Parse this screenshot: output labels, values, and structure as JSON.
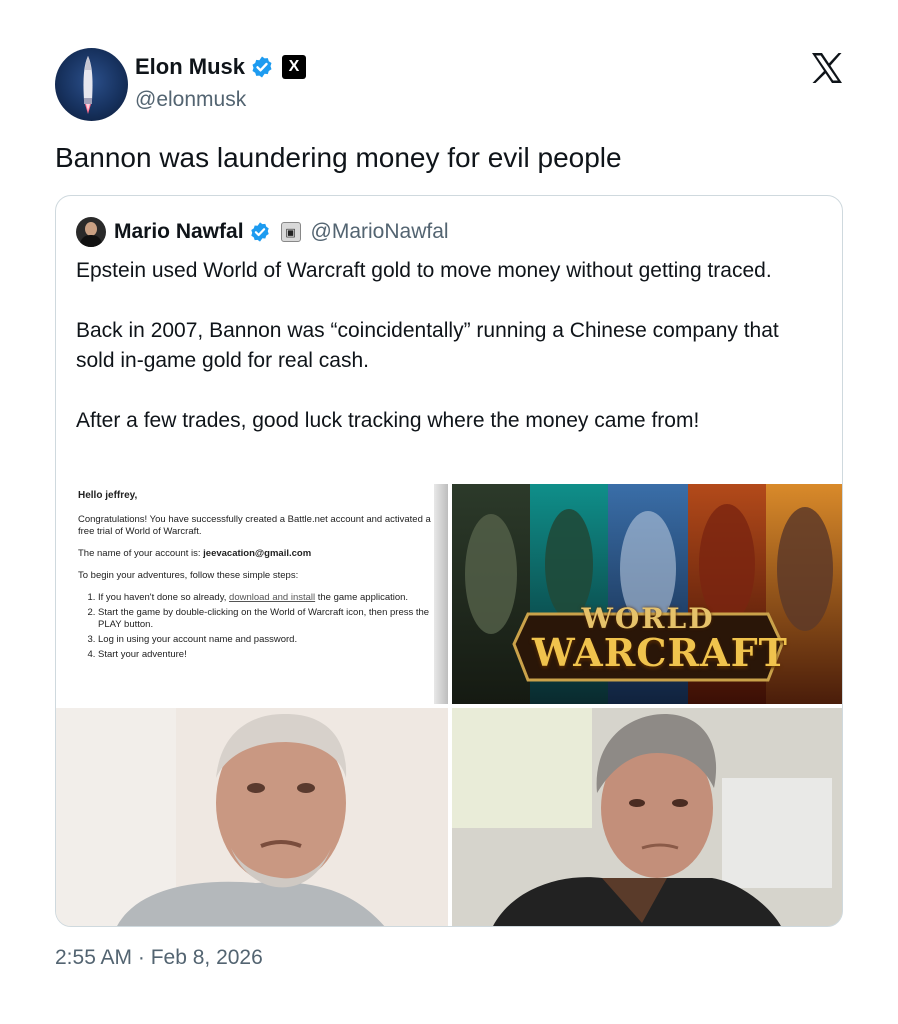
{
  "author": {
    "name": "Elon Musk",
    "handle": "@elonmusk",
    "avatar_icon": "rocket-avatar",
    "affiliation_badge": "X"
  },
  "platform_logo": "x-logo",
  "tweet": {
    "text": "Bannon was laundering money for evil people",
    "timestamp": "2:55 AM · Feb 8, 2026"
  },
  "quoted_tweet": {
    "name": "Mario Nawfal",
    "handle": "@MarioNawfal",
    "paragraphs": [
      "Epstein used World of Warcraft gold to move money without getting traced.",
      "Back in 2007, Bannon was “coincidentally” running a Chinese company that sold in-game gold for real cash.",
      "After a few trades, good luck tracking where the money came from!"
    ],
    "media": {
      "email": {
        "greeting": "Hello jeffrey,",
        "line1": "Congratulations! You have successfully created a Battle.net account and activated a free trial of World of Warcraft.",
        "line2_prefix": "The name of your account is: ",
        "line2_account": "jeevacation@gmail.com",
        "line3": "To begin your adventures, follow these simple steps:",
        "step1_prefix": "If you haven't done so already, ",
        "step1_link": "download and install",
        "step1_suffix": " the game application.",
        "step2": "Start the game by double-clicking on the World of Warcraft icon, then press the PLAY button.",
        "step3": "Log in using your account name and password.",
        "step4": "Start your adventure!"
      },
      "wow_banner": {
        "logo_line1": "WORLD",
        "logo_line2": "WARCRAFT"
      },
      "photo_left": "portrait-photo",
      "photo_right": "portrait-photo"
    }
  },
  "colors": {
    "verified_blue": "#1d9bf0",
    "text_primary": "#0f1419",
    "text_secondary": "#536471",
    "border": "#cfd9de"
  }
}
